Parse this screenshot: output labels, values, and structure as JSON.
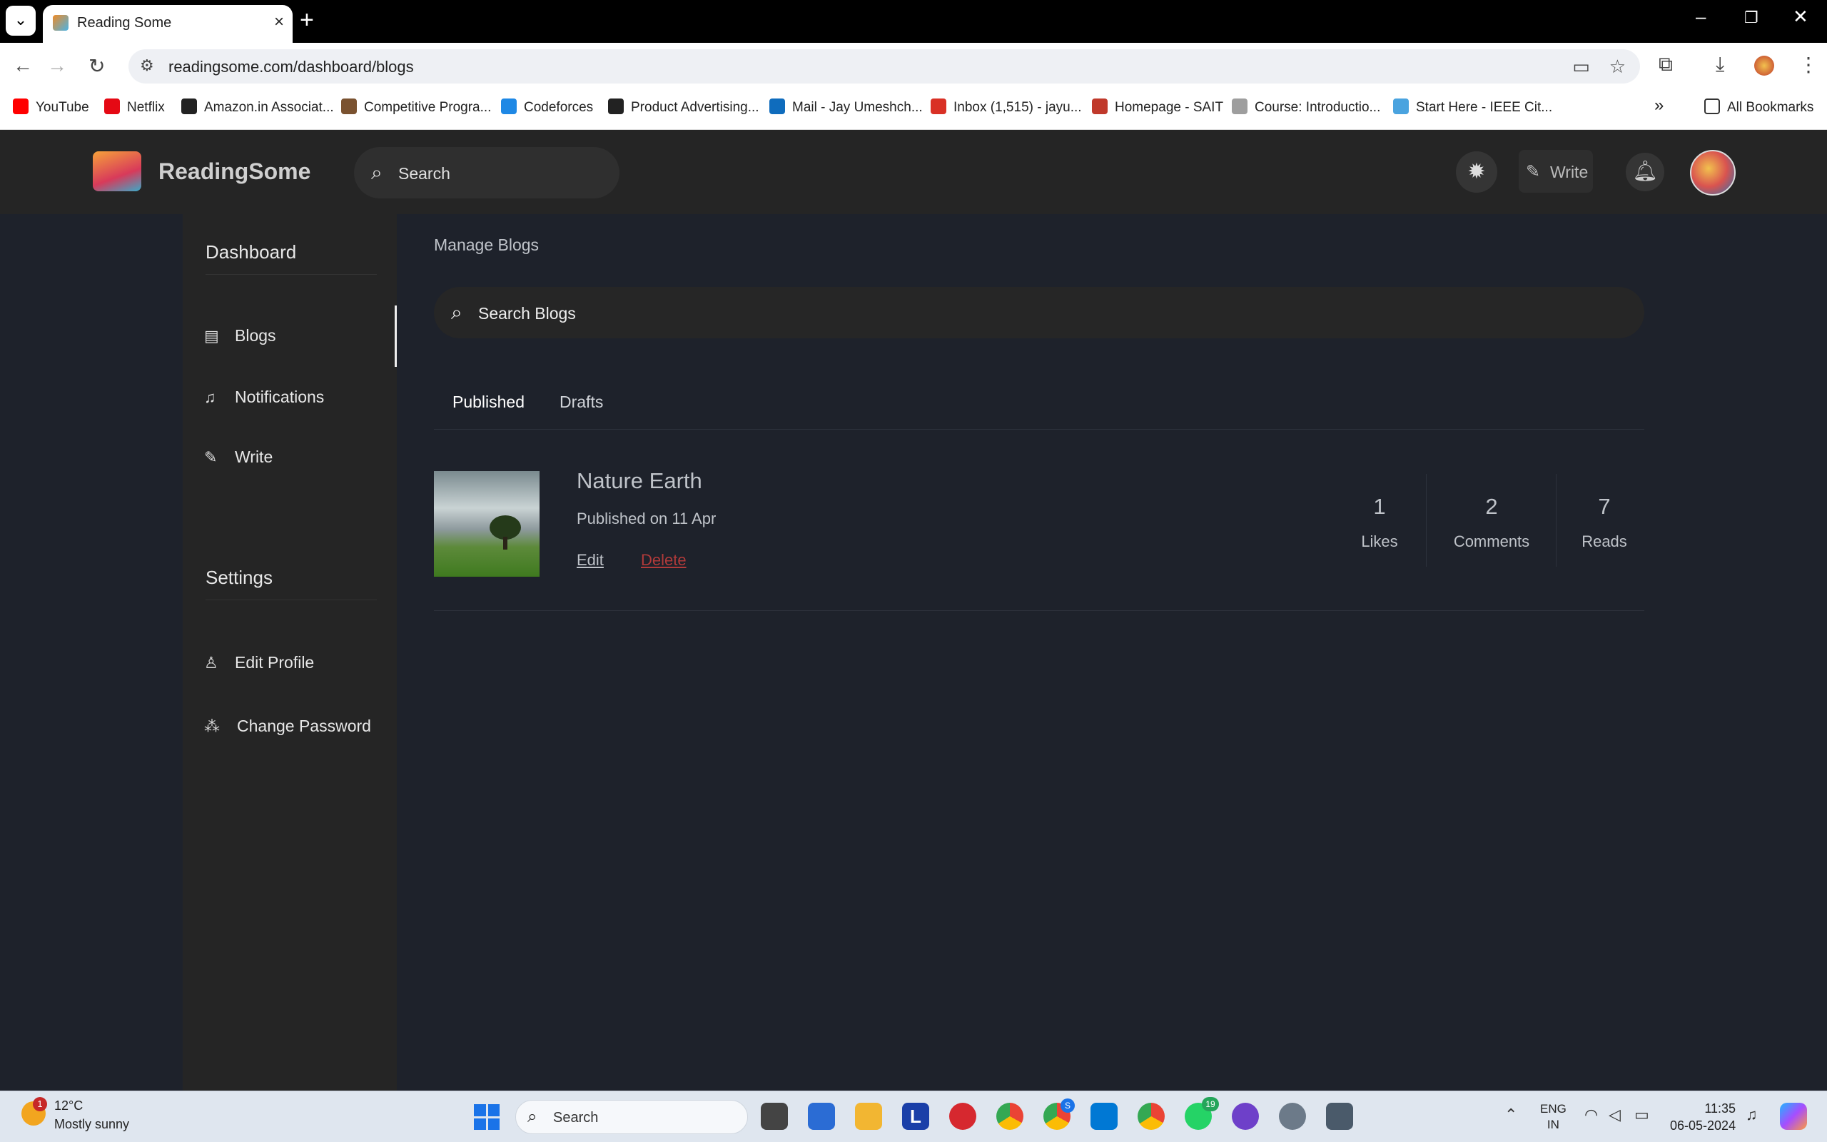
{
  "browser": {
    "tab_title": "Reading Some",
    "url": "readingsome.com/dashboard/blogs",
    "bookmarks": [
      {
        "label": "YouTube",
        "color": "#ff0000"
      },
      {
        "label": "Netflix",
        "color": "#e50914"
      },
      {
        "label": "Amazon.in Associat...",
        "color": "#222222"
      },
      {
        "label": "Competitive Progra...",
        "color": "#7a5230"
      },
      {
        "label": "Codeforces",
        "color": "#1e88e5"
      },
      {
        "label": "Product Advertising...",
        "color": "#222222"
      },
      {
        "label": "Mail - Jay Umeshch...",
        "color": "#0f6cbd"
      },
      {
        "label": "Inbox (1,515) - jayu...",
        "color": "#d93025"
      },
      {
        "label": "Homepage - SAIT",
        "color": "#c0392b"
      },
      {
        "label": "Course: Introductio...",
        "color": "#9e9e9e"
      },
      {
        "label": "Start Here - IEEE Cit...",
        "color": "#4aa3df"
      }
    ],
    "all_bookmarks": "All Bookmarks",
    "more_bookmarks": "»"
  },
  "header": {
    "brand": "ReadingSome",
    "search_placeholder": "Search",
    "write_label": "Write"
  },
  "sidebar": {
    "dashboard_heading": "Dashboard",
    "items": [
      {
        "label": "Blogs",
        "icon": "document-icon"
      },
      {
        "label": "Notifications",
        "icon": "bell-icon"
      },
      {
        "label": "Write",
        "icon": "edit-icon"
      }
    ],
    "settings_heading": "Settings",
    "settings_items": [
      {
        "label": "Edit Profile",
        "icon": "user-icon"
      },
      {
        "label": "Change Password",
        "icon": "password-icon"
      }
    ]
  },
  "main": {
    "title": "Manage Blogs",
    "search_placeholder": "Search Blogs",
    "tabs": [
      {
        "label": "Published",
        "active": true
      },
      {
        "label": "Drafts",
        "active": false
      }
    ],
    "blogs": [
      {
        "title": "Nature Earth",
        "published": "Published on 11 Apr",
        "edit_label": "Edit",
        "delete_label": "Delete",
        "stats": [
          {
            "value": "1",
            "label": "Likes"
          },
          {
            "value": "2",
            "label": "Comments"
          },
          {
            "value": "7",
            "label": "Reads"
          }
        ]
      }
    ]
  },
  "taskbar": {
    "weather_badge": "1",
    "temperature": "12°C",
    "condition": "Mostly sunny",
    "search_label": "Search",
    "lang_top": "ENG",
    "lang_bottom": "IN",
    "time": "11:35",
    "date": "06-05-2024",
    "whatsapp_badge": "19",
    "edge_badge": "S"
  },
  "colors": {
    "page_bg": "#1e222b",
    "header_bg": "#252525",
    "delete": "#b03a3a"
  }
}
